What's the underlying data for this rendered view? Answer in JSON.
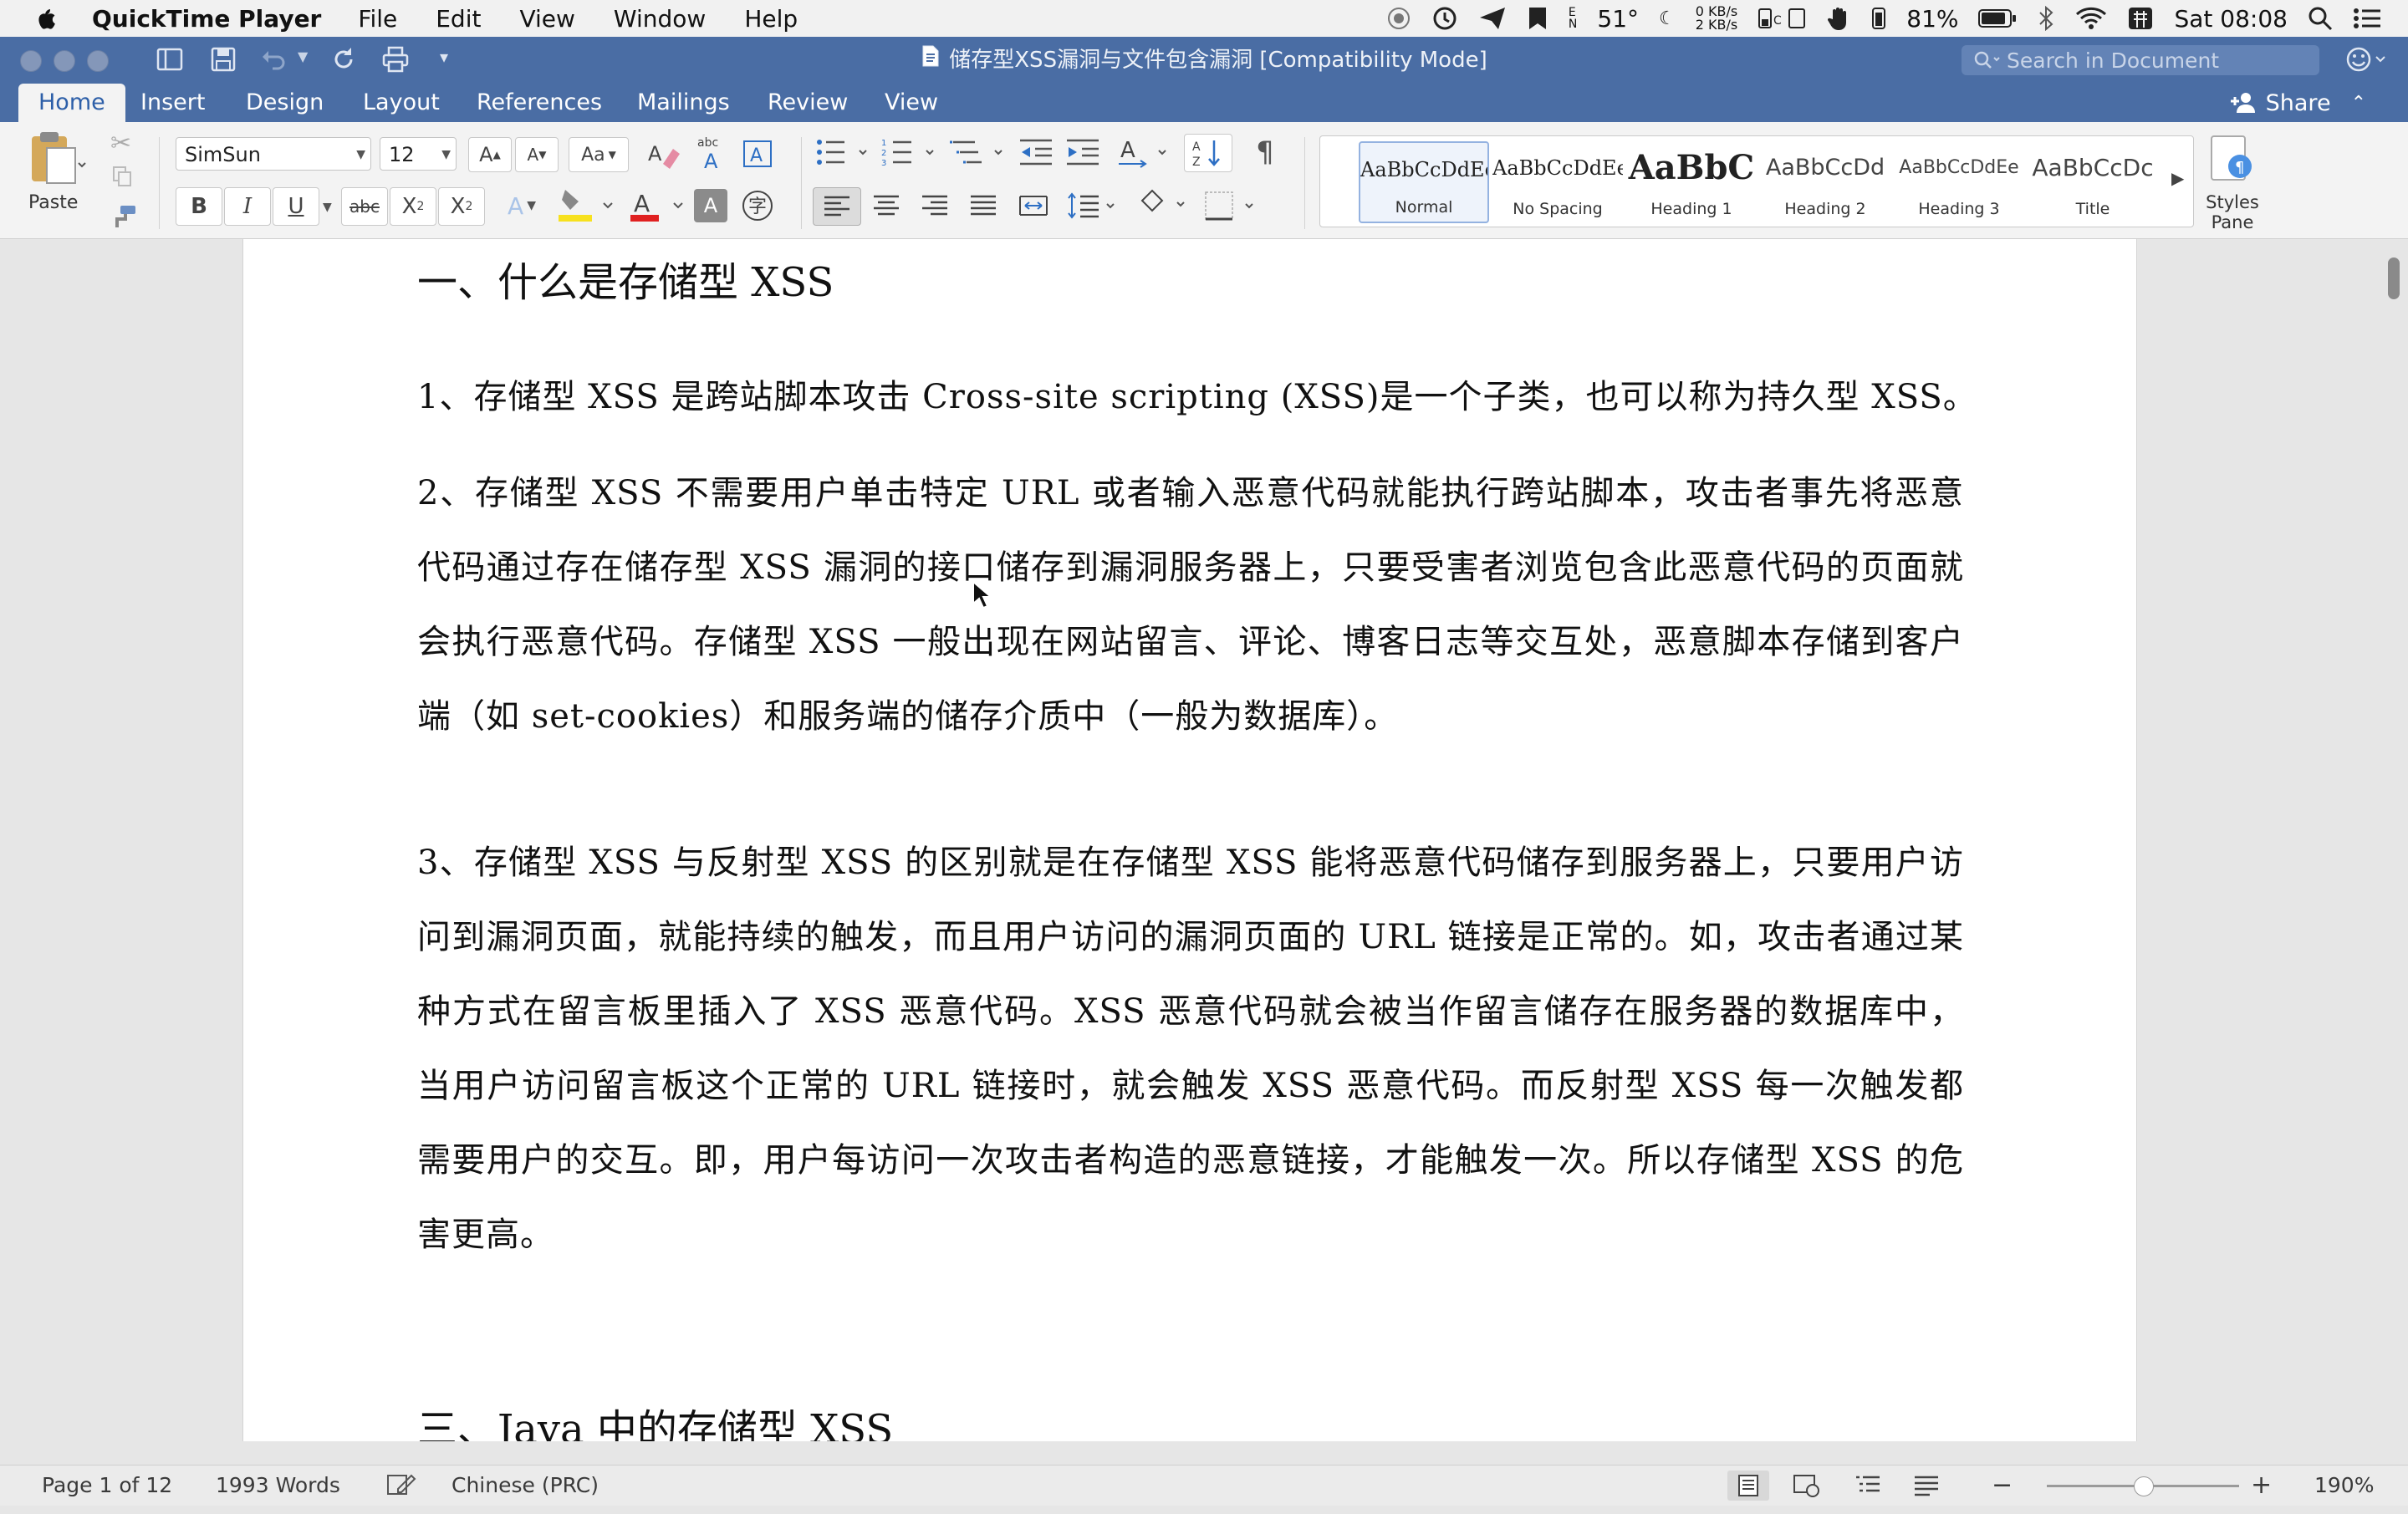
{
  "menubar": {
    "app_name": "QuickTime Player",
    "menus": [
      "File",
      "Edit",
      "View",
      "Window",
      "Help"
    ],
    "status": {
      "temperature": "51°",
      "net_up": "0 KB/s",
      "net_down": "2 KB/s",
      "battery": "81%",
      "clock": "Sat 08:08",
      "icons": [
        "record-icon",
        "time-machine-icon",
        "paper-plane-icon",
        "bookmark-icon",
        "keyboard-icon",
        "memory-icon",
        "hand-icon",
        "battery-icon",
        "bluetooth-icon",
        "wifi-icon",
        "input-method-icon",
        "spotlight-icon",
        "notification-center-icon"
      ]
    }
  },
  "window": {
    "title": "储存型XSS漏洞与文件包含漏洞 [Compatibility Mode]",
    "search_placeholder": "Search in Document"
  },
  "ribbon_tabs": {
    "items": [
      "Home",
      "Insert",
      "Design",
      "Layout",
      "References",
      "Mailings",
      "Review",
      "View"
    ],
    "active": "Home",
    "share_label": "Share"
  },
  "ribbon": {
    "paste_label": "Paste",
    "font_name": "SimSun",
    "font_size": "12",
    "styles": [
      {
        "preview": "AaBbCcDdEe",
        "name": "Normal"
      },
      {
        "preview": "AaBbCcDdEe",
        "name": "No Spacing"
      },
      {
        "preview": "AaBbC",
        "name": "Heading 1"
      },
      {
        "preview": "AaBbCcDd",
        "name": "Heading 2"
      },
      {
        "preview": "AaBbCcDdEe",
        "name": "Heading 3"
      },
      {
        "preview": "AaBbCcDc",
        "name": "Title"
      }
    ],
    "styles_pane_label": "Styles Pane"
  },
  "document": {
    "heading1": "一、什么是存储型 XSS",
    "para1": "1、存储型 XSS 是跨站脚本攻击 Cross-site scripting (XSS)是一个子类，也可以称为持久型 XSS。",
    "para2": "2、存储型 XSS 不需要用户单击特定 URL 或者输入恶意代码就能执行跨站脚本，攻击者事先将恶意代码通过存在储存型 XSS 漏洞的接口储存到漏洞服务器上，只要受害者浏览包含此恶意代码的页面就会执行恶意代码。存储型 XSS 一般出现在网站留言、评论、博客日志等交互处，恶意脚本存储到客户端（如 set-cookies）和服务端的储存介质中（一般为数据库）。",
    "para3": "3、存储型 XSS 与反射型 XSS 的区别就是在存储型 XSS 能将恶意代码储存到服务器上，只要用户访问到漏洞页面，就能持续的触发，而且用户访问的漏洞页面的 URL 链接是正常的。如，攻击者通过某种方式在留言板里插入了 XSS 恶意代码。XSS 恶意代码就会被当作留言储存在服务器的数据库中，当用户访问留言板这个正常的 URL 链接时，就会触发 XSS 恶意代码。而反射型 XSS 每一次触发都需要用户的交互。即，用户每访问一次攻击者构造的恶意链接，才能触发一次。所以存储型 XSS 的危害更高。",
    "heading3": "三、Java 中的存储型 XSS"
  },
  "statusbar": {
    "page": "Page 1 of 12",
    "words": "1993 Words",
    "language": "Chinese (PRC)",
    "zoom": "190%"
  }
}
